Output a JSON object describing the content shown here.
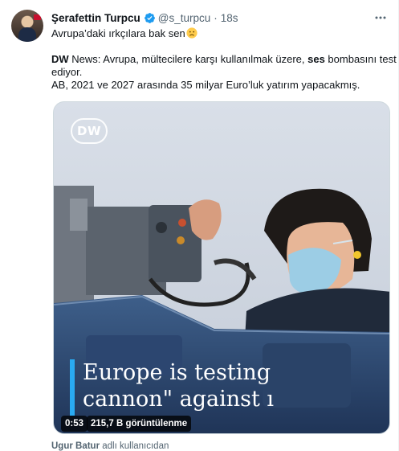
{
  "tweet": {
    "author_name": "Şerafettin Turpcu",
    "handle": "@s_turpcu",
    "separator": "·",
    "time": "18s",
    "intro_text": "Avrupa’daki ırkçılara bak sen",
    "intro_emoji": "frowning-face-icon",
    "news_source": "DW",
    "news_line1_rest": " News: Avrupa, mültecilere karşı kullanılmak üzere, ",
    "news_highlight": "ses",
    "news_line1_tail": " bombasını test",
    "news_line2": "ediyor.",
    "news_line3": "AB, 2021 ve 2027 arasında 35 milyar Euro’luk yatırım yapacakmış."
  },
  "media": {
    "logo_text": "DW",
    "caption_line1": "Europe is testing",
    "caption_line2": "cannon\" against ı",
    "time_left": "0:53",
    "views": "215,7 B görüntülenme"
  },
  "attribution": {
    "user": "Ugur Batur",
    "suffix": " adlı kullanıcıdan"
  },
  "colors": {
    "verified": "#1d9bf0",
    "caption_accent": "#29aaf2",
    "secondary_text": "#536471"
  }
}
